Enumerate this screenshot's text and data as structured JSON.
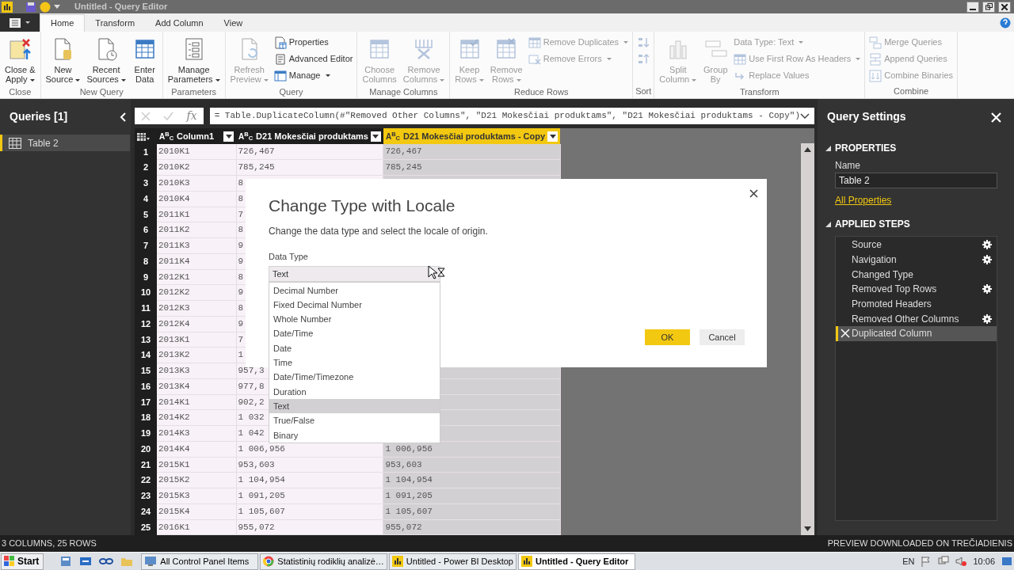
{
  "window": {
    "title": "Untitled - Query Editor"
  },
  "ribbon": {
    "tabs": [
      {
        "label": "Home",
        "selected": true
      },
      {
        "label": "Transform",
        "selected": false
      },
      {
        "label": "Add Column",
        "selected": false
      },
      {
        "label": "View",
        "selected": false
      }
    ],
    "groups": [
      {
        "label": "Close",
        "items": [
          {
            "kind": "large",
            "lines": [
              "Close &",
              "Apply"
            ],
            "menu": true,
            "disabled": false
          }
        ]
      },
      {
        "label": "New Query",
        "items": [
          {
            "kind": "large",
            "lines": [
              "New",
              "Source"
            ],
            "menu": true,
            "disabled": false
          },
          {
            "kind": "large",
            "lines": [
              "Recent",
              "Sources"
            ],
            "menu": true,
            "disabled": false
          },
          {
            "kind": "large",
            "lines": [
              "Enter",
              "Data"
            ],
            "menu": false,
            "disabled": false
          }
        ]
      },
      {
        "label": "Parameters",
        "items": [
          {
            "kind": "large",
            "lines": [
              "Manage",
              "Parameters"
            ],
            "menu": true,
            "disabled": false
          }
        ]
      },
      {
        "label": "Query",
        "items": [
          {
            "kind": "large",
            "lines": [
              "Refresh",
              "Preview"
            ],
            "menu": true,
            "disabled": true
          },
          {
            "kind": "stack",
            "items": [
              {
                "label": "Properties",
                "menu": false,
                "disabled": false
              },
              {
                "label": "Advanced Editor",
                "menu": false,
                "disabled": false
              },
              {
                "label": "Manage",
                "menu": true,
                "disabled": false
              }
            ]
          }
        ]
      },
      {
        "label": "Manage Columns",
        "items": [
          {
            "kind": "large",
            "lines": [
              "Choose",
              "Columns"
            ],
            "menu": false,
            "disabled": true
          },
          {
            "kind": "large",
            "lines": [
              "Remove",
              "Columns"
            ],
            "menu": true,
            "disabled": true
          }
        ]
      },
      {
        "label": "Reduce Rows",
        "items": [
          {
            "kind": "large",
            "lines": [
              "Keep",
              "Rows"
            ],
            "menu": true,
            "disabled": true
          },
          {
            "kind": "large",
            "lines": [
              "Remove",
              "Rows"
            ],
            "menu": true,
            "disabled": true
          },
          {
            "kind": "stack",
            "items": [
              {
                "label": "Remove Duplicates",
                "menu": true,
                "disabled": true
              },
              {
                "label": "Remove Errors",
                "menu": true,
                "disabled": true
              }
            ]
          }
        ]
      },
      {
        "label": "Sort",
        "items": [
          {
            "kind": "stack",
            "items": [
              {
                "menu": false,
                "disabled": true
              },
              {
                "menu": false,
                "disabled": true
              }
            ]
          }
        ]
      },
      {
        "label": "Transform",
        "items": [
          {
            "kind": "large",
            "lines": [
              "Split",
              "Column"
            ],
            "menu": true,
            "disabled": true
          },
          {
            "kind": "large",
            "lines": [
              "Group",
              "By"
            ],
            "menu": false,
            "disabled": true
          },
          {
            "kind": "stack",
            "items": [
              {
                "label": "Data Type: Text",
                "menu": true,
                "disabled": true
              },
              {
                "label": "Use First Row As Headers",
                "menu": true,
                "disabled": true
              },
              {
                "label": "Replace Values",
                "menu": false,
                "disabled": true
              }
            ]
          }
        ]
      },
      {
        "label": "Combine",
        "items": [
          {
            "kind": "stack",
            "items": [
              {
                "label": "Merge Queries",
                "menu": false,
                "disabled": true
              },
              {
                "label": "Append Queries",
                "menu": false,
                "disabled": true
              },
              {
                "label": "Combine Binaries",
                "menu": false,
                "disabled": true
              }
            ]
          }
        ]
      }
    ]
  },
  "queries": {
    "title": "Queries [1]",
    "items": [
      {
        "label": "Table 2",
        "selected": true
      }
    ]
  },
  "formula_bar": {
    "function_label": "fx",
    "formula": "= Table.DuplicateColumn(#\"Removed Other Columns\", \"D21 Mokesčiai produktams\", \"D21 Mokesčiai produktams - Copy\")"
  },
  "table": {
    "columns": [
      {
        "type_label": "A$^{B}$$_{C}$",
        "label": "Column1",
        "selected": false
      },
      {
        "type_label": "A$^{B}$$_{C}$",
        "label": "D21 Mokesčiai produktams",
        "selected": false
      },
      {
        "type_label": "A$^{B}$$_{C}$",
        "label": "D21 Mokesčiai produktams - Copy",
        "selected": true
      }
    ],
    "rows": [
      {
        "number": "1",
        "cells": [
          "2010K1",
          "726,467",
          "726,467"
        ]
      },
      {
        "number": "2",
        "cells": [
          "2010K2",
          "785,245",
          "785,245"
        ]
      },
      {
        "number": "3",
        "cells": [
          "2010K3",
          "8"
        ]
      },
      {
        "number": "4",
        "cells": [
          "2010K4",
          "8"
        ]
      },
      {
        "number": "5",
        "cells": [
          "2011K1",
          "7"
        ]
      },
      {
        "number": "6",
        "cells": [
          "2011K2",
          "8"
        ]
      },
      {
        "number": "7",
        "cells": [
          "2011K3",
          "9"
        ]
      },
      {
        "number": "8",
        "cells": [
          "2011K4",
          "9"
        ]
      },
      {
        "number": "9",
        "cells": [
          "2012K1",
          "8"
        ]
      },
      {
        "number": "10",
        "cells": [
          "2012K2",
          "9"
        ]
      },
      {
        "number": "11",
        "cells": [
          "2012K3",
          "8"
        ]
      },
      {
        "number": "12",
        "cells": [
          "2012K4",
          "9"
        ]
      },
      {
        "number": "13",
        "cells": [
          "2013K1",
          "7"
        ]
      },
      {
        "number": "14",
        "cells": [
          "2013K2",
          "1"
        ]
      },
      {
        "number": "15",
        "cells": [
          "2013K3",
          "957,3"
        ]
      },
      {
        "number": "16",
        "cells": [
          "2013K4",
          "977,8"
        ]
      },
      {
        "number": "17",
        "cells": [
          "2014K1",
          "902,2"
        ]
      },
      {
        "number": "18",
        "cells": [
          "2014K2",
          "1 032"
        ]
      },
      {
        "number": "19",
        "cells": [
          "2014K3",
          "1 042"
        ]
      },
      {
        "number": "20",
        "cells": [
          "2014K4",
          "1 006,956",
          "1 006,956"
        ]
      },
      {
        "number": "21",
        "cells": [
          "2015K1",
          "953,603",
          "953,603"
        ]
      },
      {
        "number": "22",
        "cells": [
          "2015K2",
          "1 104,954",
          "1 104,954"
        ]
      },
      {
        "number": "23",
        "cells": [
          "2015K3",
          "1 091,205",
          "1 091,205"
        ]
      },
      {
        "number": "24",
        "cells": [
          "2015K4",
          "1 105,607",
          "1 105,607"
        ]
      },
      {
        "number": "25",
        "cells": [
          "2016K1",
          "955,072",
          "955,072"
        ]
      }
    ]
  },
  "query_settings": {
    "title": "Query Settings",
    "properties_heading": "PROPERTIES",
    "name_label": "Name",
    "name_value": "Table 2",
    "all_properties_link": "All Properties",
    "steps_heading": "APPLIED STEPS",
    "steps": [
      {
        "label": "Source",
        "settings": true,
        "selected": false
      },
      {
        "label": "Navigation",
        "settings": true,
        "selected": false
      },
      {
        "label": "Changed Type",
        "settings": false,
        "selected": false
      },
      {
        "label": "Removed Top Rows",
        "settings": true,
        "selected": false
      },
      {
        "label": "Promoted Headers",
        "settings": false,
        "selected": false
      },
      {
        "label": "Removed Other Columns",
        "settings": true,
        "selected": false
      },
      {
        "label": "Duplicated Column",
        "settings": false,
        "selected": true
      }
    ]
  },
  "dialog": {
    "title": "Change Type with Locale",
    "description": "Change the data type and select the locale of origin.",
    "field_label": "Data Type",
    "value": "Text",
    "options": [
      {
        "label": "Decimal Number",
        "selected": false
      },
      {
        "label": "Fixed Decimal Number",
        "selected": false
      },
      {
        "label": "Whole Number",
        "selected": false
      },
      {
        "label": "Date/Time",
        "selected": false
      },
      {
        "label": "Date",
        "selected": false
      },
      {
        "label": "Time",
        "selected": false
      },
      {
        "label": "Date/Time/Timezone",
        "selected": false
      },
      {
        "label": "Duration",
        "selected": false
      },
      {
        "label": "Text",
        "selected": true
      },
      {
        "label": "True/False",
        "selected": false
      },
      {
        "label": "Binary",
        "selected": false
      }
    ],
    "buttons": [
      {
        "label": "OK",
        "kind": "primary"
      },
      {
        "label": "Cancel",
        "kind": "secondary"
      }
    ]
  },
  "status_bar": {
    "left": "3 COLUMNS, 25 ROWS",
    "right": "PREVIEW DOWNLOADED ON TREČIADIENIS"
  },
  "taskbar": {
    "start": "Start",
    "tasks": [
      {
        "label": "All Control Panel Items",
        "active": false
      },
      {
        "label": "Statistinių rodiklių analizė…",
        "active": false
      },
      {
        "label": "Untitled - Power BI Desktop",
        "active": false
      },
      {
        "label": "Untitled - Query Editor",
        "active": true
      }
    ],
    "language": "EN",
    "time": "10:06"
  }
}
